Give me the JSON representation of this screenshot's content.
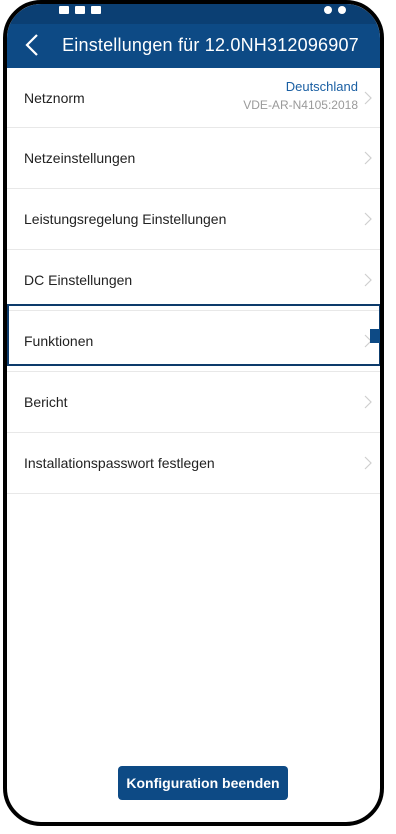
{
  "header": {
    "title": "Einstellungen für 12.0NH312096907",
    "back_icon": "chevron-left-icon"
  },
  "settings": {
    "netznorm": {
      "label": "Netznorm",
      "value_country": "Deutschland",
      "value_standard": "VDE-AR-N4105:2018"
    },
    "items": [
      {
        "label": "Netzeinstellungen"
      },
      {
        "label": "Leistungsregelung Einstellungen"
      },
      {
        "label": "DC Einstellungen"
      },
      {
        "label": "Funktionen"
      },
      {
        "label": "Bericht"
      },
      {
        "label": "Installationspasswort festlegen"
      }
    ]
  },
  "footer": {
    "finish_label": "Konfiguration beenden"
  },
  "colors": {
    "header_bg": "#0d4a85",
    "accent_text": "#1a5fa3",
    "highlight_border": "#0d3b6b"
  }
}
